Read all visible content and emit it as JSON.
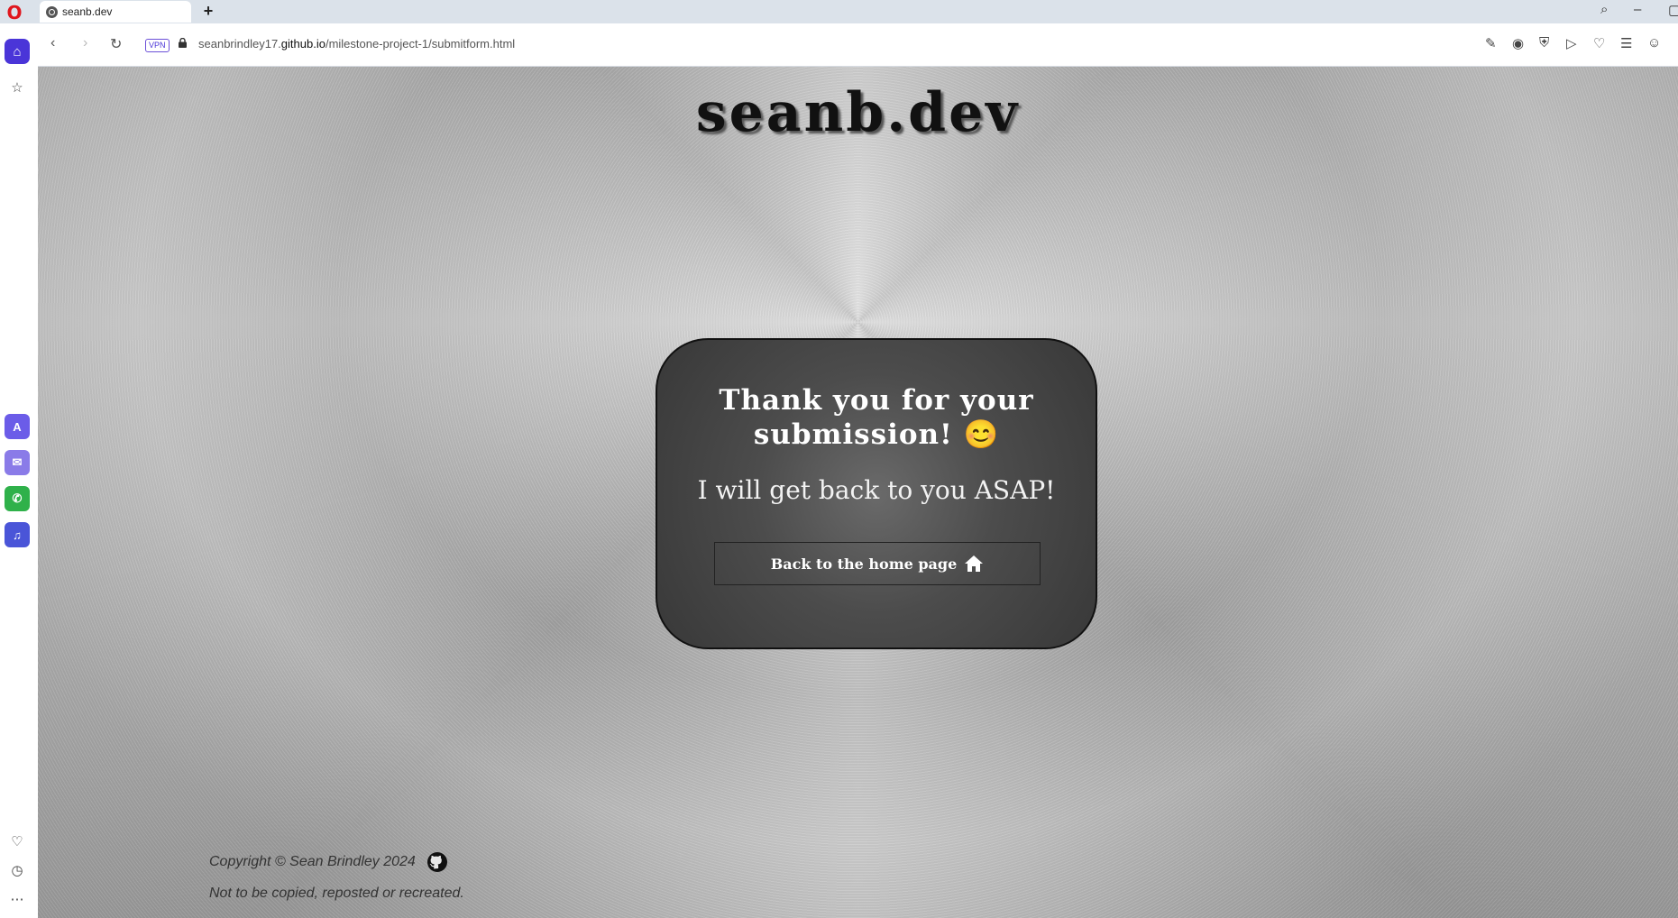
{
  "browser": {
    "tab_title": "seanb.dev",
    "new_tab_label": "+",
    "vpn_label": "VPN",
    "url_prefix": "seanbrindley17.",
    "url_host": "github.io",
    "url_path": "/milestone-project-1/submitform.html"
  },
  "page": {
    "site_title": "seanb.dev",
    "heading_line1": "Thank you for your",
    "heading_line2": "submission! 😊",
    "message": "I will get back to you ASAP!",
    "home_button_label": "Back to the home page",
    "copyright": "Copyright © Sean Brindley 2024",
    "notice": "Not to be copied, reposted or recreated."
  },
  "colors": {
    "accent": "#4a35d8",
    "card_bg": "#4c4c4c"
  }
}
